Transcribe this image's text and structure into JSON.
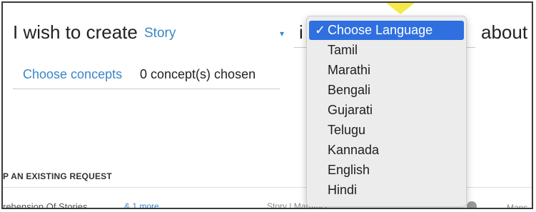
{
  "form": {
    "intro_text": "I wish to create",
    "story_value": "Story",
    "in_text": "i",
    "about_text": "about",
    "caret_glyph": "▾"
  },
  "concepts": {
    "link_label": "Choose concepts",
    "count_text": "0 concept(s) chosen"
  },
  "existing": {
    "heading": "P AN EXISTING REQUEST",
    "row_title": "rehension Of Stories",
    "row_more": "& 1 more",
    "row_tags": "Story  |  Marathi  |",
    "row_owner": "Mans"
  },
  "language_dropdown": {
    "selected_prefix": "✓",
    "options": [
      "Choose Language",
      "Tamil",
      "Marathi",
      "Bengali",
      "Gujarati",
      "Telugu",
      "Kannada",
      "English",
      "Hindi"
    ],
    "selected_index": 0
  },
  "colors": {
    "accent": "#3a86c8",
    "selected_bg": "#2f6fe0",
    "pointer": "#f6e94a"
  }
}
